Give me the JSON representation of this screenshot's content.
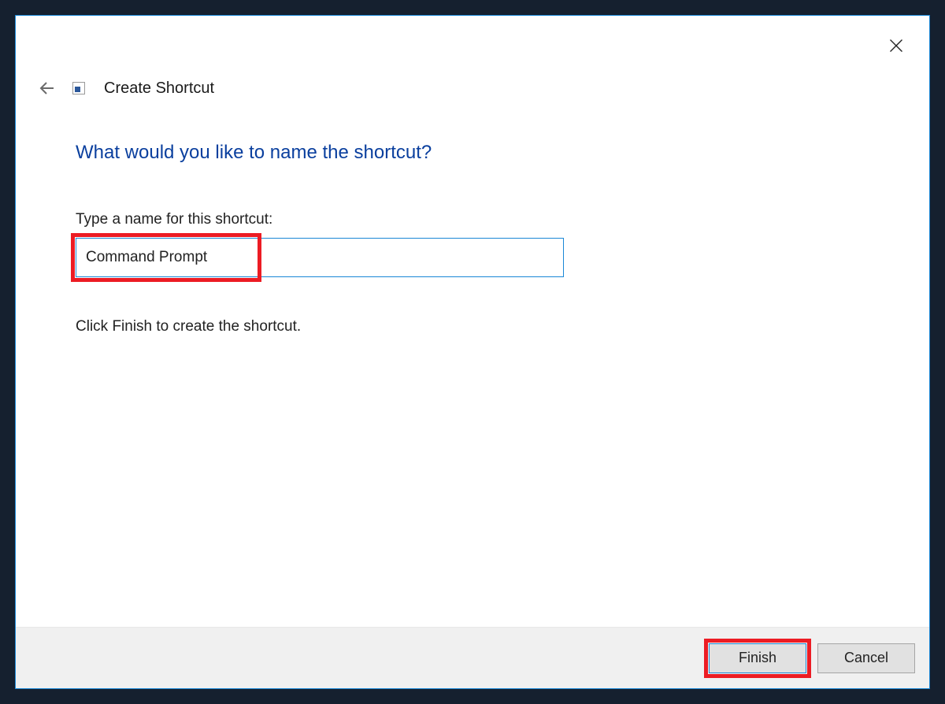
{
  "dialog": {
    "title": "Create Shortcut",
    "heading": "What would you like to name the shortcut?",
    "field_label": "Type a name for this shortcut:",
    "name_value": "Command Prompt",
    "hint": "Click Finish to create the shortcut."
  },
  "footer": {
    "finish_label": "Finish",
    "cancel_label": "Cancel"
  }
}
